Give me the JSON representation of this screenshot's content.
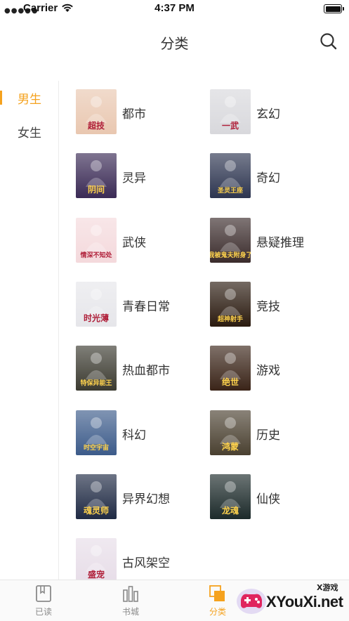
{
  "status_bar": {
    "carrier": "Carrier",
    "time": "4:37 PM"
  },
  "nav": {
    "title": "分类"
  },
  "sidebar": {
    "items": [
      {
        "label": "男生",
        "active": true
      },
      {
        "label": "女生",
        "active": false
      }
    ]
  },
  "categories": [
    {
      "name": "都市",
      "cover_text": "超技",
      "cover_color": "#e9c7b0"
    },
    {
      "name": "玄幻",
      "cover_text": "一武",
      "cover_color": "#d8d8dc"
    },
    {
      "name": "灵异",
      "cover_text": "阴间",
      "cover_color": "#3a2a55"
    },
    {
      "name": "奇幻",
      "cover_text": "圣灵王座",
      "cover_color": "#2d3550"
    },
    {
      "name": "武侠",
      "cover_text": "情深不知处",
      "cover_color": "#f4d9dc"
    },
    {
      "name": "悬疑推理",
      "cover_text": "我被鬼夫附身了",
      "cover_color": "#3a2b2b"
    },
    {
      "name": "青春日常",
      "cover_text": "时光薄",
      "cover_color": "#e6e6ea"
    },
    {
      "name": "竞技",
      "cover_text": "超神射手",
      "cover_color": "#2a1a0f"
    },
    {
      "name": "热血都市",
      "cover_text": "特保异能王",
      "cover_color": "#3b3a30"
    },
    {
      "name": "游戏",
      "cover_text": "绝世",
      "cover_color": "#3a2418"
    },
    {
      "name": "科幻",
      "cover_text": "时空宇宙",
      "cover_color": "#3c5b8a"
    },
    {
      "name": "历史",
      "cover_text": "鸿蒙",
      "cover_color": "#4a4030"
    },
    {
      "name": "异界幻想",
      "cover_text": "魂灵师",
      "cover_color": "#1f2a44"
    },
    {
      "name": "仙侠",
      "cover_text": "龙魂",
      "cover_color": "#1c2a2a"
    },
    {
      "name": "古风架空",
      "cover_text": "盛宠",
      "cover_color": "#e7dde8"
    }
  ],
  "tabbar": {
    "items": [
      {
        "label": "已读",
        "icon": "book-icon",
        "active": false
      },
      {
        "label": "书城",
        "icon": "bookshelf-icon",
        "active": false
      },
      {
        "label": "分类",
        "icon": "category-icon",
        "active": true
      }
    ]
  },
  "watermark": {
    "text": "XYouXi.net",
    "tag": "X游戏"
  },
  "colors": {
    "accent": "#f5a21e",
    "text": "#333333",
    "muted": "#8a8a8a"
  }
}
